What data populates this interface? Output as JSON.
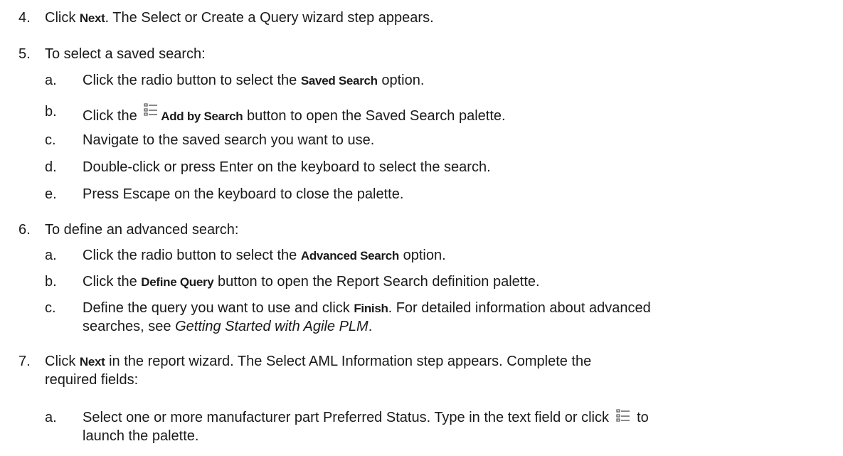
{
  "steps": [
    {
      "num": "4.",
      "pre": "Click ",
      "bold": "Next",
      "post": ". The Select or Create a Query wizard step appears."
    },
    {
      "num": "5.",
      "text": "To select a saved search:",
      "sub": [
        {
          "ltr": "a.",
          "pre": "Click the radio button to select the ",
          "bold": "Saved Search",
          "post": " option."
        },
        {
          "ltr": "b.",
          "pre": "Click the ",
          "bold": "Add by Search",
          "post": " button to open the Saved Search palette."
        },
        {
          "ltr": "c.",
          "text": "Navigate to the saved search you want to use."
        },
        {
          "ltr": "d.",
          "text": "Double-click or press Enter on the keyboard to select the search."
        },
        {
          "ltr": "e.",
          "text": "Press Escape on the keyboard to close the palette."
        }
      ]
    },
    {
      "num": "6.",
      "text": "To define an advanced search:",
      "sub": [
        {
          "ltr": "a.",
          "pre": "Click the radio button to select the ",
          "bold": "Advanced Search",
          "post": " option."
        },
        {
          "ltr": "b.",
          "pre": "Click the ",
          "bold": "Define Query",
          "post": " button to open the Report Search definition palette."
        },
        {
          "ltr": "c.",
          "pre": "Define the query you want to use and click ",
          "bold": "Finish",
          "post": ". For detailed information about advanced",
          "line2_pre": "searches, see ",
          "line2_italic": "Getting Started with Agile PLM",
          "line2_post": "."
        }
      ]
    },
    {
      "num": "7.",
      "pre": "Click ",
      "bold": "Next",
      "post": " in the report wizard. The Select AML Information step appears. Complete the",
      "line2": "required fields:",
      "sub": [
        {
          "ltr": "a.",
          "pre": "Select one or more manufacturer part Preferred Status. Type in the text field or click ",
          "post": " to",
          "line2": "launch the palette."
        }
      ]
    }
  ],
  "icons": {
    "add_by_search": "list-icon",
    "palette_launch": "list-icon"
  }
}
